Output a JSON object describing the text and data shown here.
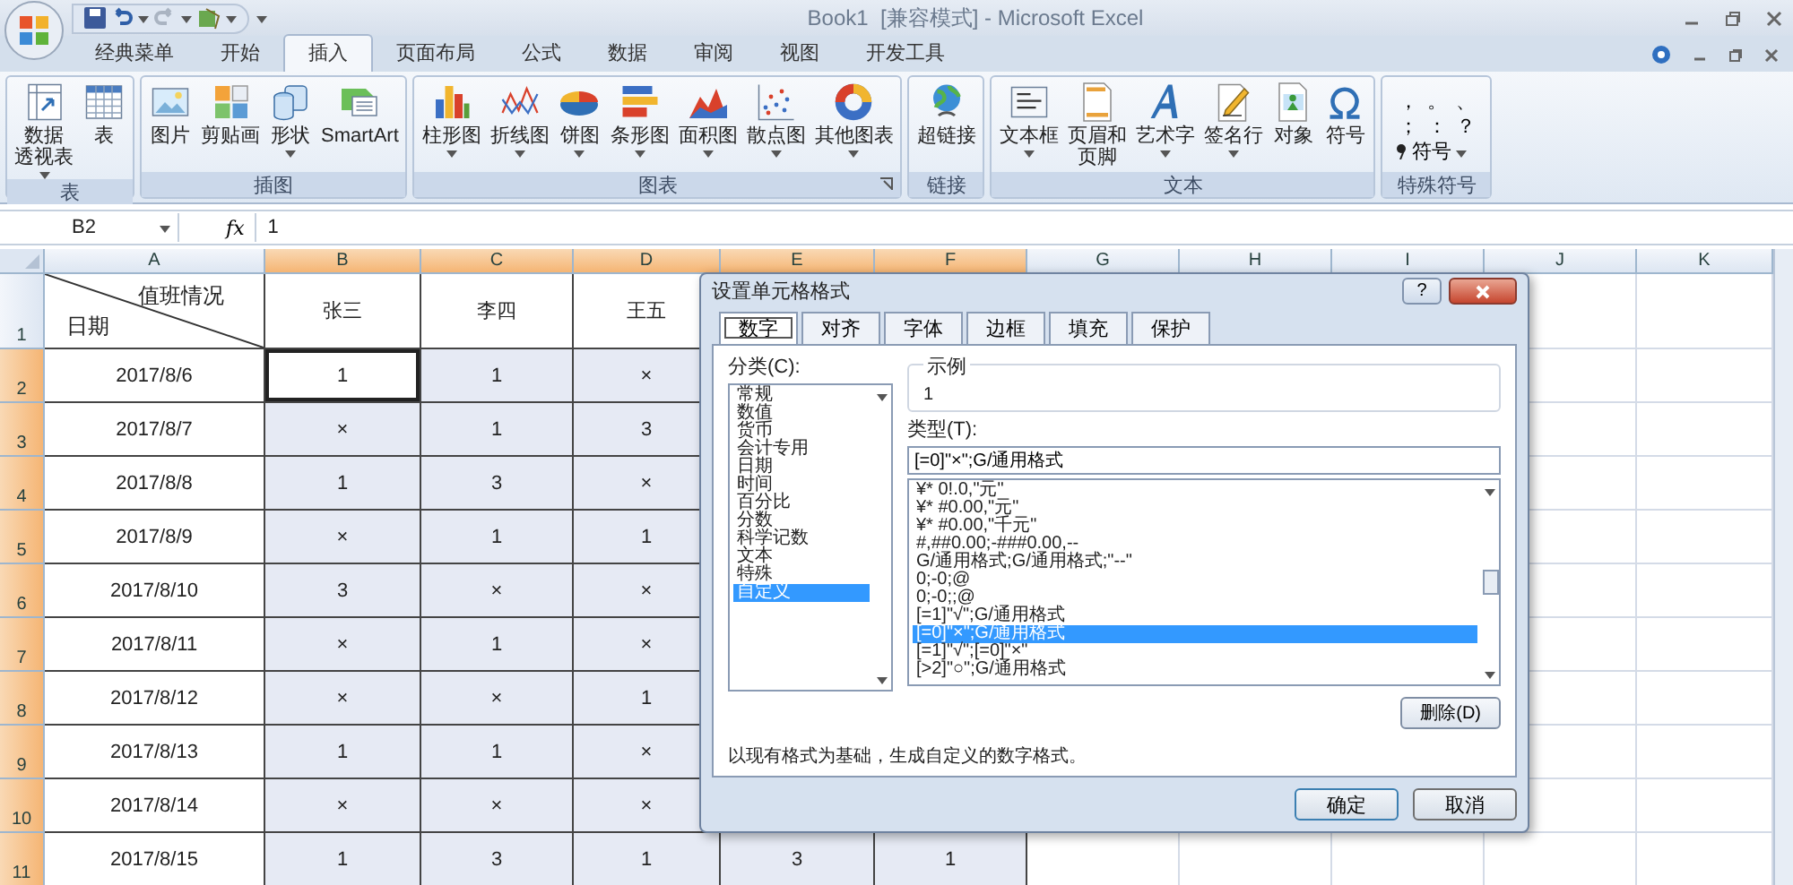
{
  "window": {
    "title": "Book1  [兼容模式] - Microsoft Excel"
  },
  "ribbon": {
    "tabs": [
      {
        "label": "经典菜单",
        "selected": false
      },
      {
        "label": "开始",
        "selected": false
      },
      {
        "label": "插入",
        "selected": true
      },
      {
        "label": "页面布局",
        "selected": false
      },
      {
        "label": "公式",
        "selected": false
      },
      {
        "label": "数据",
        "selected": false
      },
      {
        "label": "审阅",
        "selected": false
      },
      {
        "label": "视图",
        "selected": false
      },
      {
        "label": "开发工具",
        "selected": false
      }
    ],
    "groups": [
      {
        "label": "表",
        "kind": "buttons",
        "launcher": false,
        "buttons": [
          {
            "lines": [
              "数据",
              "透视表"
            ],
            "dropdown": true
          },
          {
            "lines": [
              "表"
            ],
            "dropdown": false
          }
        ]
      },
      {
        "label": "插图",
        "kind": "buttons",
        "launcher": false,
        "buttons": [
          {
            "lines": [
              "图片"
            ],
            "dropdown": false
          },
          {
            "lines": [
              "剪贴画"
            ],
            "dropdown": false
          },
          {
            "lines": [
              "形状"
            ],
            "dropdown": true
          },
          {
            "lines": [
              "SmartArt"
            ],
            "dropdown": false
          }
        ]
      },
      {
        "label": "图表",
        "kind": "buttons",
        "launcher": true,
        "buttons": [
          {
            "lines": [
              "柱形图"
            ],
            "dropdown": true
          },
          {
            "lines": [
              "折线图"
            ],
            "dropdown": true
          },
          {
            "lines": [
              "饼图"
            ],
            "dropdown": true
          },
          {
            "lines": [
              "条形图"
            ],
            "dropdown": true
          },
          {
            "lines": [
              "面积图"
            ],
            "dropdown": true
          },
          {
            "lines": [
              "散点图"
            ],
            "dropdown": true
          },
          {
            "lines": [
              "其他图表"
            ],
            "dropdown": true
          }
        ]
      },
      {
        "label": "链接",
        "kind": "buttons",
        "launcher": false,
        "buttons": [
          {
            "lines": [
              "超链接"
            ],
            "dropdown": false
          }
        ]
      },
      {
        "label": "文本",
        "kind": "buttons",
        "launcher": false,
        "buttons": [
          {
            "lines": [
              "文本框"
            ],
            "dropdown": true
          },
          {
            "lines": [
              "页眉和",
              "页脚"
            ],
            "dropdown": false
          },
          {
            "lines": [
              "艺术字"
            ],
            "dropdown": true
          },
          {
            "lines": [
              "签名行"
            ],
            "dropdown": true
          },
          {
            "lines": [
              "对象"
            ],
            "dropdown": false
          },
          {
            "lines": [
              "符号"
            ],
            "dropdown": false
          }
        ]
      },
      {
        "label": "特殊符号",
        "kind": "symbols",
        "launcher": false,
        "symbols": [
          "，",
          "。",
          "、",
          "；",
          "：",
          "？"
        ],
        "button": "符号"
      }
    ]
  },
  "formula_bar": {
    "name_box": "B2",
    "function_button": "fx",
    "formula": "1"
  },
  "sheet": {
    "columns": [
      {
        "letter": "A",
        "selected": false
      },
      {
        "letter": "B",
        "selected": true
      },
      {
        "letter": "C",
        "selected": true
      },
      {
        "letter": "D",
        "selected": true
      },
      {
        "letter": "E",
        "selected": true
      },
      {
        "letter": "F",
        "selected": true
      },
      {
        "letter": "G",
        "selected": false
      },
      {
        "letter": "H",
        "selected": false
      },
      {
        "letter": "I",
        "selected": false
      },
      {
        "letter": "J",
        "selected": false
      },
      {
        "letter": "K",
        "selected": false
      }
    ],
    "header_row": {
      "number": "1",
      "selected": false,
      "corner": {
        "top": "值班情况",
        "bottom": "日期"
      },
      "cells": [
        "张三",
        "李四",
        "王五"
      ]
    },
    "rows": [
      {
        "number": "2",
        "selected": true,
        "cells": [
          {
            "text": "2017/8/6",
            "active": false
          },
          {
            "text": "1",
            "active": true
          },
          {
            "text": "1",
            "active": false
          },
          {
            "text": "×",
            "active": false
          }
        ]
      },
      {
        "number": "3",
        "selected": true,
        "cells": [
          {
            "text": "2017/8/7",
            "active": false
          },
          {
            "text": "×",
            "active": false
          },
          {
            "text": "1",
            "active": false
          },
          {
            "text": "3",
            "active": false
          }
        ]
      },
      {
        "number": "4",
        "selected": true,
        "cells": [
          {
            "text": "2017/8/8",
            "active": false
          },
          {
            "text": "1",
            "active": false
          },
          {
            "text": "3",
            "active": false
          },
          {
            "text": "×",
            "active": false
          }
        ]
      },
      {
        "number": "5",
        "selected": true,
        "cells": [
          {
            "text": "2017/8/9",
            "active": false
          },
          {
            "text": "×",
            "active": false
          },
          {
            "text": "1",
            "active": false
          },
          {
            "text": "1",
            "active": false
          }
        ]
      },
      {
        "number": "6",
        "selected": true,
        "cells": [
          {
            "text": "2017/8/10",
            "active": false
          },
          {
            "text": "3",
            "active": false
          },
          {
            "text": "×",
            "active": false
          },
          {
            "text": "×",
            "active": false
          }
        ]
      },
      {
        "number": "7",
        "selected": true,
        "cells": [
          {
            "text": "2017/8/11",
            "active": false
          },
          {
            "text": "×",
            "active": false
          },
          {
            "text": "1",
            "active": false
          },
          {
            "text": "×",
            "active": false
          }
        ]
      },
      {
        "number": "8",
        "selected": true,
        "cells": [
          {
            "text": "2017/8/12",
            "active": false
          },
          {
            "text": "×",
            "active": false
          },
          {
            "text": "×",
            "active": false
          },
          {
            "text": "1",
            "active": false
          }
        ]
      },
      {
        "number": "9",
        "selected": true,
        "cells": [
          {
            "text": "2017/8/13",
            "active": false
          },
          {
            "text": "1",
            "active": false
          },
          {
            "text": "1",
            "active": false
          },
          {
            "text": "×",
            "active": false
          }
        ]
      },
      {
        "number": "10",
        "selected": true,
        "cells": [
          {
            "text": "2017/8/14",
            "active": false
          },
          {
            "text": "×",
            "active": false
          },
          {
            "text": "×",
            "active": false
          },
          {
            "text": "×",
            "active": false
          }
        ]
      },
      {
        "number": "11",
        "selected": true,
        "cells": [
          {
            "text": "2017/8/15",
            "active": false
          },
          {
            "text": "1",
            "active": false
          },
          {
            "text": "3",
            "active": false
          },
          {
            "text": "1",
            "active": false
          },
          {
            "text": "3",
            "active": false
          },
          {
            "text": "1",
            "active": false
          }
        ]
      }
    ]
  },
  "dialog": {
    "title": "设置单元格格式",
    "help_button": "?",
    "tabs": [
      {
        "label": "数字",
        "selected": true
      },
      {
        "label": "对齐",
        "selected": false
      },
      {
        "label": "字体",
        "selected": false
      },
      {
        "label": "边框",
        "selected": false
      },
      {
        "label": "填充",
        "selected": false
      },
      {
        "label": "保护",
        "selected": false
      }
    ],
    "category_label": "分类(C):",
    "categories": [
      {
        "label": "常规",
        "selected": false
      },
      {
        "label": "数值",
        "selected": false
      },
      {
        "label": "货币",
        "selected": false
      },
      {
        "label": "会计专用",
        "selected": false
      },
      {
        "label": "日期",
        "selected": false
      },
      {
        "label": "时间",
        "selected": false
      },
      {
        "label": "百分比",
        "selected": false
      },
      {
        "label": "分数",
        "selected": false
      },
      {
        "label": "科学记数",
        "selected": false
      },
      {
        "label": "文本",
        "selected": false
      },
      {
        "label": "特殊",
        "selected": false
      },
      {
        "label": "自定义",
        "selected": true
      }
    ],
    "sample_label": "示例",
    "sample_value": "1",
    "type_label": "类型(T):",
    "type_value": "[=0]\"×\";G/通用格式",
    "formats": [
      {
        "label": "¥* 0!.0,\"元\"",
        "selected": false
      },
      {
        "label": "¥* #0.00,\"元\"",
        "selected": false
      },
      {
        "label": "¥* #0.00,\"千元\"",
        "selected": false
      },
      {
        "label": "#,##0.00;-###0.00,--",
        "selected": false
      },
      {
        "label": "G/通用格式;G/通用格式;\"--\"",
        "selected": false
      },
      {
        "label": "0;-0;@",
        "selected": false
      },
      {
        "label": "0;-0;;@",
        "selected": false
      },
      {
        "label": "[=1]\"√\";G/通用格式",
        "selected": false
      },
      {
        "label": "[=0]\"×\";G/通用格式",
        "selected": true
      },
      {
        "label": "[=1]\"√\";[=0]\"×\"",
        "selected": false
      },
      {
        "label": "[>2]\"○\";G/通用格式",
        "selected": false
      }
    ],
    "delete_button": "删除(D)",
    "description": "以现有格式为基础，生成自定义的数字格式。",
    "buttons": [
      "确定",
      "取消"
    ]
  }
}
